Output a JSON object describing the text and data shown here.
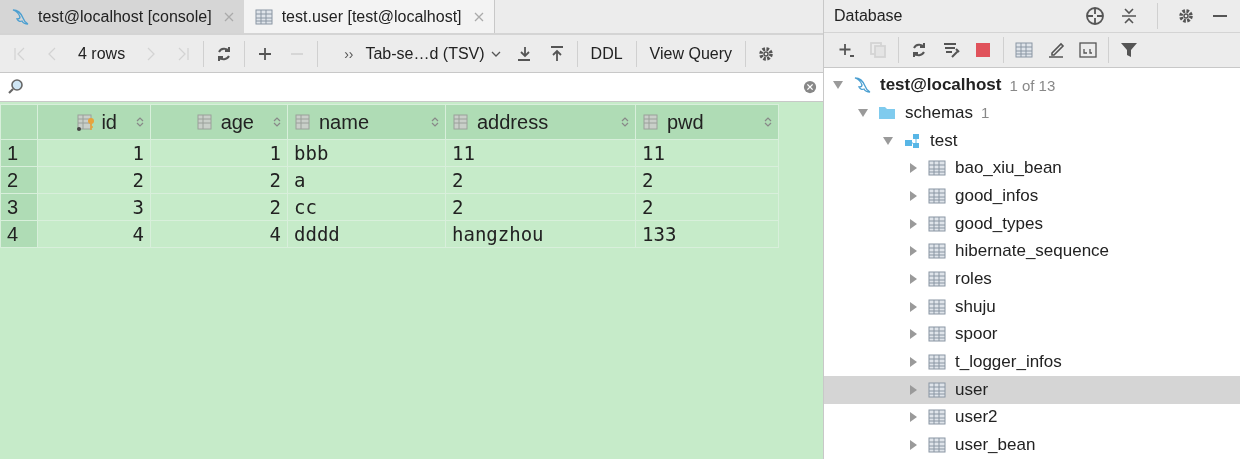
{
  "editor": {
    "tabs": [
      {
        "label": "test@localhost [console]",
        "kind": "console",
        "selected": false
      },
      {
        "label": "test.user [test@localhost]",
        "kind": "table",
        "selected": true
      }
    ],
    "toolbar": {
      "items": [
        {
          "kind": "first",
          "disabled": true
        },
        {
          "kind": "prev",
          "disabled": true
        },
        {
          "kind": "rows",
          "label": "4 rows"
        },
        {
          "kind": "next",
          "disabled": true
        },
        {
          "kind": "last",
          "disabled": true
        },
        {
          "kind": "sep"
        },
        {
          "kind": "reload",
          "disabled": false
        },
        {
          "kind": "sep"
        },
        {
          "kind": "add",
          "disabled": false
        },
        {
          "kind": "remove",
          "disabled": true
        },
        {
          "kind": "sep"
        },
        {
          "kind": "format",
          "prefix": "››",
          "label": "Tab-se…d (TSV)"
        },
        {
          "kind": "download",
          "disabled": false
        },
        {
          "kind": "upload",
          "disabled": false
        },
        {
          "kind": "sep"
        },
        {
          "kind": "text",
          "label": "DDL"
        },
        {
          "kind": "sep"
        },
        {
          "kind": "text",
          "label": "View Query"
        },
        {
          "kind": "sep"
        },
        {
          "kind": "settings",
          "disabled": false
        }
      ]
    },
    "grid": {
      "columns": [
        {
          "name": "id",
          "kind": "number",
          "key": true
        },
        {
          "name": "age",
          "kind": "number",
          "key": false
        },
        {
          "name": "name",
          "kind": "text",
          "key": false
        },
        {
          "name": "address",
          "kind": "text",
          "key": false
        },
        {
          "name": "pwd",
          "kind": "text",
          "key": false
        }
      ],
      "rows": [
        {
          "num": "1",
          "cells": [
            "1",
            "1",
            "bbb",
            "11",
            "11"
          ]
        },
        {
          "num": "2",
          "cells": [
            "2",
            "2",
            "a",
            "2",
            "2"
          ]
        },
        {
          "num": "3",
          "cells": [
            "3",
            "2",
            "cc",
            "2",
            "2"
          ]
        },
        {
          "num": "4",
          "cells": [
            "4",
            "4",
            "dddd",
            "hangzhou",
            "133"
          ]
        }
      ]
    }
  },
  "database": {
    "title": "Database",
    "toolbar": [
      {
        "kind": "add",
        "disabled": false
      },
      {
        "kind": "duplicate",
        "disabled": true
      },
      {
        "kind": "sep"
      },
      {
        "kind": "refresh",
        "disabled": false
      },
      {
        "kind": "properties",
        "disabled": false
      },
      {
        "kind": "stop",
        "disabled": false
      },
      {
        "kind": "sep"
      },
      {
        "kind": "table",
        "disabled": false
      },
      {
        "kind": "edit",
        "disabled": false
      },
      {
        "kind": "console",
        "disabled": false
      },
      {
        "kind": "sep"
      },
      {
        "kind": "filter",
        "disabled": false
      }
    ],
    "tree": [
      {
        "label": "test@localhost",
        "kind": "connection",
        "count": "1 of 13",
        "expanded": true,
        "selected": false,
        "children": [
          {
            "label": "schemas",
            "kind": "folder",
            "count": "1",
            "expanded": true,
            "selected": false,
            "children": [
              {
                "label": "test",
                "kind": "schema",
                "expanded": true,
                "selected": false,
                "children": [
                  {
                    "label": "bao_xiu_bean",
                    "kind": "table",
                    "expanded": false,
                    "selected": false
                  },
                  {
                    "label": "good_infos",
                    "kind": "table",
                    "expanded": false,
                    "selected": false
                  },
                  {
                    "label": "good_types",
                    "kind": "table",
                    "expanded": false,
                    "selected": false
                  },
                  {
                    "label": "hibernate_sequence",
                    "kind": "table",
                    "expanded": false,
                    "selected": false
                  },
                  {
                    "label": "roles",
                    "kind": "table",
                    "expanded": false,
                    "selected": false
                  },
                  {
                    "label": "shuju",
                    "kind": "table",
                    "expanded": false,
                    "selected": false
                  },
                  {
                    "label": "spoor",
                    "kind": "table",
                    "expanded": false,
                    "selected": false
                  },
                  {
                    "label": "t_logger_infos",
                    "kind": "table",
                    "expanded": false,
                    "selected": false
                  },
                  {
                    "label": "user",
                    "kind": "table",
                    "expanded": false,
                    "selected": true
                  },
                  {
                    "label": "user2",
                    "kind": "table",
                    "expanded": false,
                    "selected": false
                  },
                  {
                    "label": "user_bean",
                    "kind": "table",
                    "expanded": false,
                    "selected": false
                  }
                ]
              }
            ]
          }
        ]
      }
    ]
  }
}
